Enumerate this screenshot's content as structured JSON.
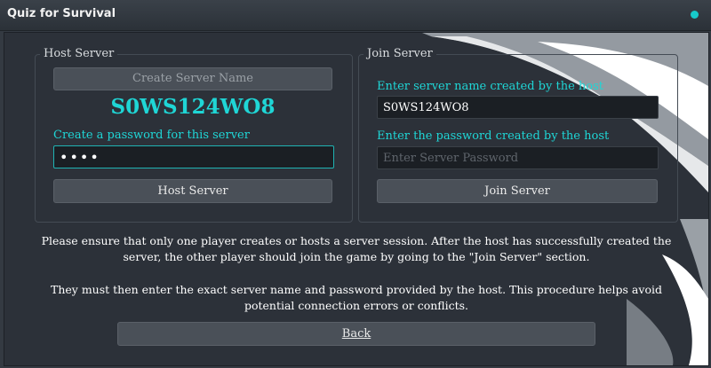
{
  "window": {
    "title": "Quiz for Survival",
    "status_color": "#17c9c9"
  },
  "host": {
    "panel_label": "Host Server",
    "name_button_label": "Create Server Name",
    "server_name": "S0WS124WO8",
    "password_prompt": "Create a password for this server",
    "password_value": "abcd",
    "host_button_label": "Host Server"
  },
  "join": {
    "panel_label": "Join Server",
    "name_prompt": "Enter server name created by the host",
    "name_value": "S0WS124WO8",
    "password_prompt": "Enter the password created by the host",
    "password_placeholder": "Enter Server Password",
    "join_button_label": "Join Server"
  },
  "info": {
    "paragraph1": "Please ensure that only one player creates or hosts a server session. After the host has successfully created the server, the other player should join the game by going to the \"Join Server\" section.",
    "paragraph2": "They must then enter the exact server name and password provided by the host. This procedure helps avoid potential connection errors or conflicts."
  },
  "footer": {
    "back_label": "Back"
  },
  "colors": {
    "accent": "#1fd6d6",
    "button_bg": "#4a5058",
    "input_bg": "#1b1f24",
    "window_bg": "#2c3139"
  },
  "icons": {
    "status": "status-dot-icon"
  }
}
